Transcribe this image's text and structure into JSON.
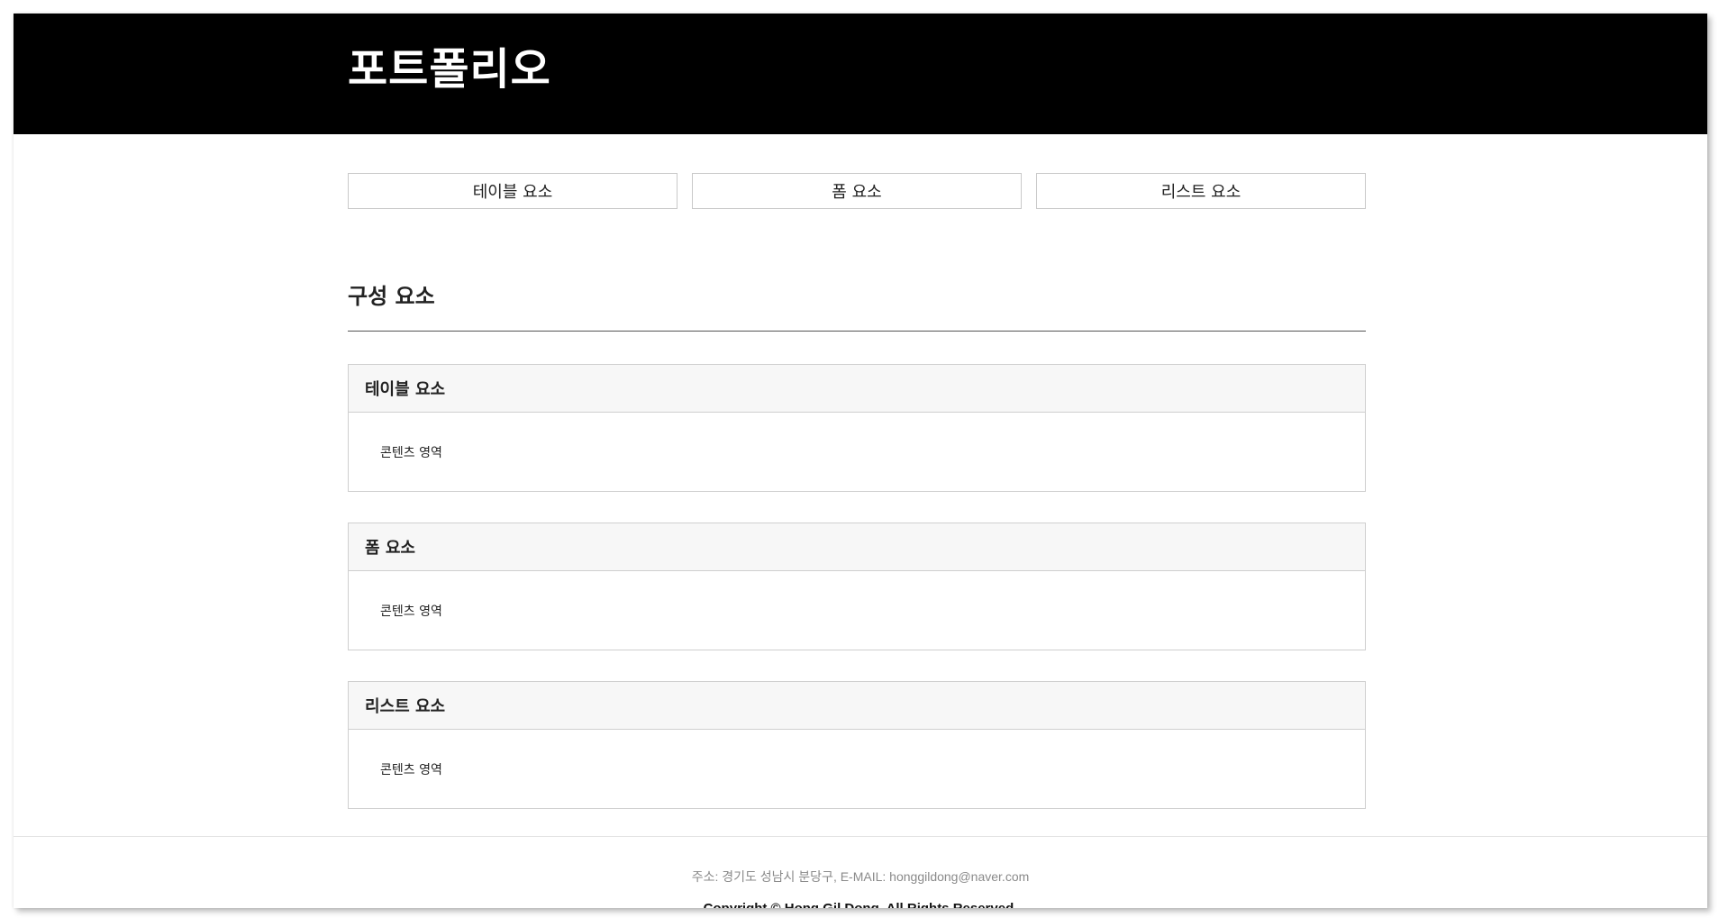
{
  "header": {
    "title": "포트폴리오"
  },
  "nav": {
    "items": [
      {
        "label": "테이블 요소"
      },
      {
        "label": "폼 요소"
      },
      {
        "label": "리스트 요소"
      }
    ]
  },
  "main": {
    "section_title": "구성 요소",
    "panels": [
      {
        "title": "테이블 요소",
        "body": "콘텐츠 영역"
      },
      {
        "title": "폼 요소",
        "body": "콘텐츠 영역"
      },
      {
        "title": "리스트 요소",
        "body": "콘텐츠 영역"
      }
    ]
  },
  "footer": {
    "address": "주소: 경기도 성남시 분당구, E-MAIL: honggildong@naver.com",
    "copyright": "Copyright © Hong Gil Dong. All Rights Reserved."
  },
  "colors": {
    "header_background": "#000000",
    "header_text": "#ffffff",
    "panel_head_background": "#f7f7f7",
    "border": "#cfcfcf",
    "footer_text": "#8a8a8a"
  }
}
